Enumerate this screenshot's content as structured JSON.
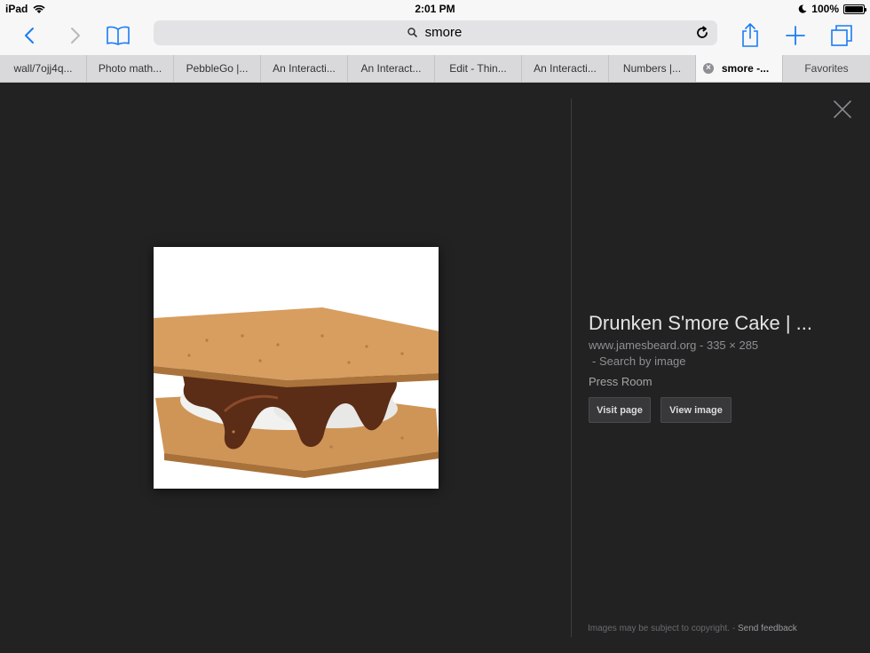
{
  "status": {
    "device": "iPad",
    "time": "2:01 PM",
    "battery": "100%"
  },
  "toolbar": {
    "back_icon": "chevron-left-icon",
    "forward_icon": "chevron-right-icon",
    "bookmarks_icon": "book-icon",
    "address_query": "smore",
    "share_icon": "share-icon",
    "new_tab_icon": "plus-icon",
    "tabs_icon": "tabs-icon",
    "accent_color": "#1a7cf5"
  },
  "tabs": [
    {
      "label": "wall/7ojj4q..."
    },
    {
      "label": "Photo math..."
    },
    {
      "label": "PebbleGo |..."
    },
    {
      "label": "An Interacti..."
    },
    {
      "label": "An Interact..."
    },
    {
      "label": "Edit - Thin..."
    },
    {
      "label": "An Interacti..."
    },
    {
      "label": "Numbers |..."
    },
    {
      "label": "smore -..."
    },
    {
      "label": "Favorites"
    }
  ],
  "result": {
    "title": "Drunken S'more Cake | ...",
    "source": "www.jamesbeard.org",
    "dimensions": "335 × 285",
    "search_by_image": "Search by image",
    "site_name": "Press Room",
    "visit_page": "Visit page",
    "view_image": "View image"
  },
  "footer": {
    "copyright": "Images may be subject to copyright.",
    "send_feedback": "Send feedback"
  }
}
